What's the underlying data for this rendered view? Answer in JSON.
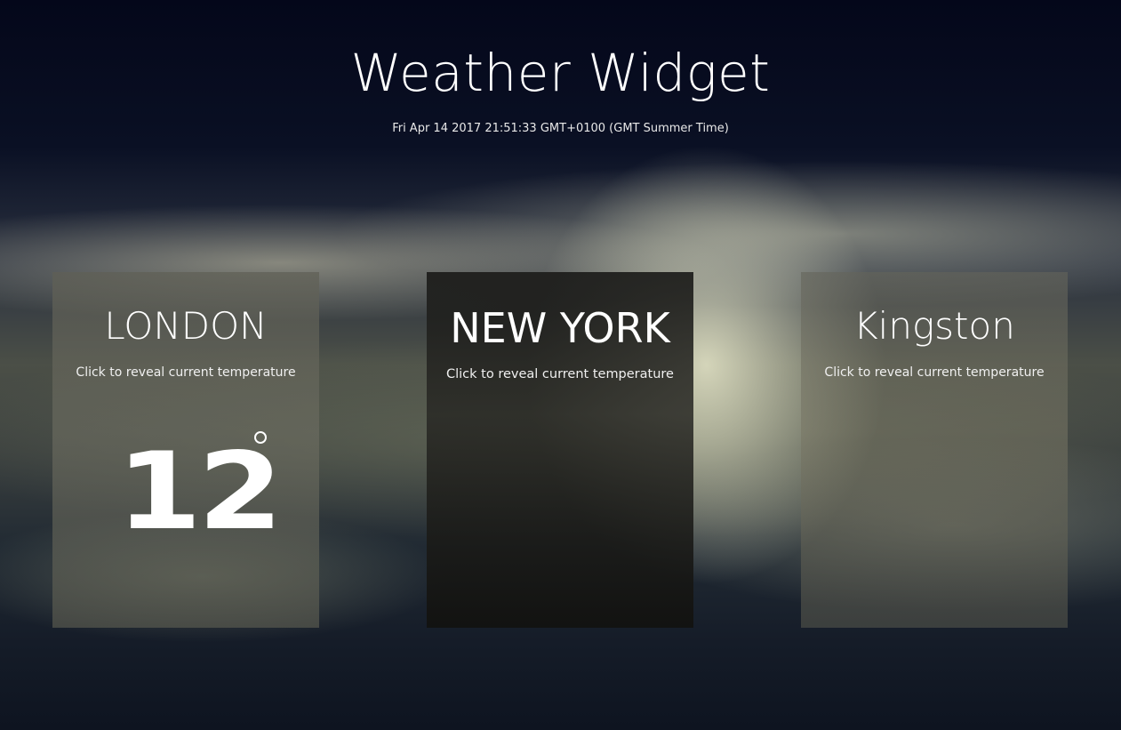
{
  "page": {
    "title": "Weather Widget",
    "datetime": "Fri Apr 14 2017 21:51:33 GMT+0100 (GMT Summer Time)"
  },
  "cards": [
    {
      "city": "LONDON",
      "hint": "Click to reveal current temperature",
      "temperature": "12",
      "degree_icon": "degree-circle-icon"
    },
    {
      "city": "NEW YORK",
      "hint": "Click to reveal current temperature"
    },
    {
      "city": "Kingston",
      "hint": "Click to reveal current temperature"
    }
  ]
}
